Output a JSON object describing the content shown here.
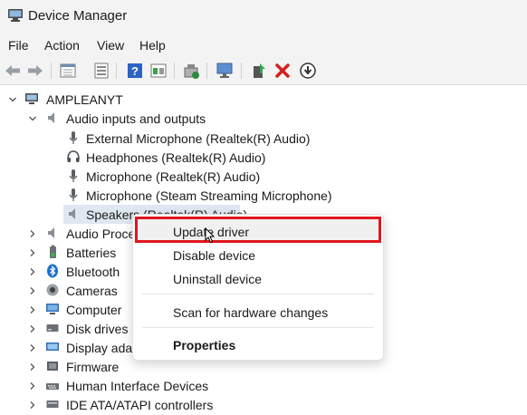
{
  "window": {
    "title": "Device Manager"
  },
  "menu": [
    "File",
    "Action",
    "View",
    "Help"
  ],
  "toolbar": {
    "buttons": [
      "back-arrow-icon",
      "forward-arrow-icon",
      "properties-grid-icon",
      "properties-sheet-icon",
      "help-icon",
      "show-hidden-icon",
      "update-driver-icon",
      "scan-hardware-icon",
      "enable-device-icon",
      "uninstall-x-icon",
      "download-circle-icon"
    ]
  },
  "tree": {
    "root": "AMPLEANYT",
    "audio_io": "Audio inputs and outputs",
    "audio_children": [
      "External Microphone (Realtek(R) Audio)",
      "Headphones (Realtek(R) Audio)",
      "Microphone (Realtek(R) Audio)",
      "Microphone (Steam Streaming Microphone)",
      "Speakers (Realtek(R) Audio)"
    ],
    "categories": [
      "Audio Proce",
      "Batteries",
      "Bluetooth",
      "Cameras",
      "Computer",
      "Disk drives",
      "Display adap",
      "Firmware",
      "Human Interface Devices",
      "IDE ATA/ATAPI controllers"
    ]
  },
  "context_menu": {
    "items": [
      "Update driver",
      "Disable device",
      "Uninstall device",
      "Scan for hardware changes",
      "Properties"
    ],
    "highlighted": "Update driver",
    "highlight_color": "#e0161d"
  }
}
